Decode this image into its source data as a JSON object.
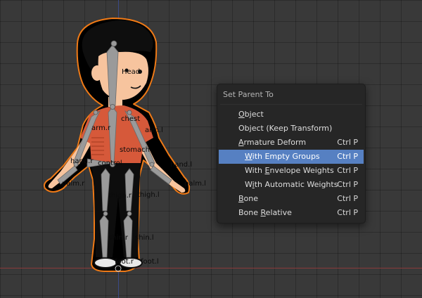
{
  "viewport": {
    "bone_labels": {
      "head": "Head",
      "chest": "chest",
      "arm_r": "arm.r",
      "arm_l": "arm.l",
      "stomach": "stomach",
      "hand_r": "hand.r",
      "control": "control",
      "hand_l": "hand.l",
      "palm_r": "palm.r",
      "palm_l": "palm.l",
      "thigh_r": "thigh.r",
      "thigh_l": "thigh.l",
      "shin_r": "shin.r",
      "shin_l": "shin.l",
      "foot_r": "foot.r",
      "foot_l": "foot.l"
    }
  },
  "menu": {
    "title": "Set Parent To",
    "items": [
      {
        "pre": "",
        "key": "O",
        "post": "bject",
        "shortcut": ""
      },
      {
        "pre": "",
        "key": "",
        "post": "Object (Keep Transform)",
        "shortcut": ""
      },
      {
        "pre": "",
        "key": "A",
        "post": "rmature Deform",
        "shortcut": "Ctrl P"
      },
      {
        "pre": "",
        "key": "W",
        "post": "ith Empty Groups",
        "shortcut": "Ctrl P"
      },
      {
        "pre": "With ",
        "key": "E",
        "post": "nvelope Weights",
        "shortcut": "Ctrl P"
      },
      {
        "pre": "W",
        "key": "i",
        "post": "th Automatic Weights",
        "shortcut": "Ctrl P"
      },
      {
        "pre": "",
        "key": "B",
        "post": "one",
        "shortcut": "Ctrl P"
      },
      {
        "pre": "Bone ",
        "key": "R",
        "post": "elative",
        "shortcut": "Ctrl P"
      }
    ],
    "active_index": 3
  },
  "colors": {
    "background": "#393939",
    "menu_bg": "#262626",
    "highlight": "#5680c2",
    "selection_outline": "#f07a16",
    "shirt": "#d6593a",
    "skin": "#f7c49e",
    "bone": "#9a9a9a"
  }
}
